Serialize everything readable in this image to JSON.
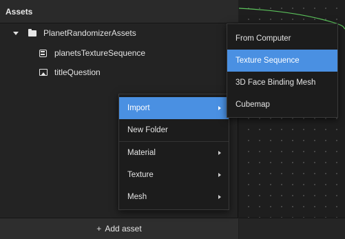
{
  "assets_panel": {
    "title": "Assets",
    "tree": [
      {
        "label": "PlanetRandomizerAssets",
        "icon": "folder-icon",
        "expanded": true
      },
      {
        "label": "planetsTextureSequence",
        "icon": "texture-sequence-icon"
      },
      {
        "label": "titleQuestion",
        "icon": "image-icon"
      }
    ],
    "add_asset": {
      "icon": "+",
      "label": "Add asset"
    }
  },
  "context_menu": {
    "items": [
      {
        "label": "Import",
        "has_submenu": true,
        "highlighted": true
      },
      {
        "label": "New Folder",
        "has_submenu": false
      },
      {
        "label": "Material",
        "has_submenu": true
      },
      {
        "label": "Texture",
        "has_submenu": true
      },
      {
        "label": "Mesh",
        "has_submenu": true
      }
    ]
  },
  "import_submenu": {
    "items": [
      {
        "label": "From Computer"
      },
      {
        "label": "Texture Sequence",
        "highlighted": true
      },
      {
        "label": "3D Face Binding Mesh"
      },
      {
        "label": "Cubemap"
      }
    ]
  },
  "colors": {
    "highlight": "#4a90e2",
    "graph_wire": "#5cc45c",
    "panel_bg": "#232323",
    "menu_bg": "#1c1c1c"
  }
}
